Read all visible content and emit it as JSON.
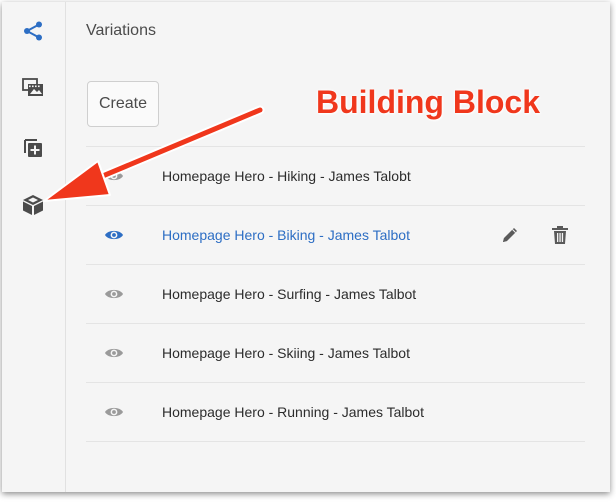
{
  "rail": {
    "items": [
      {
        "icon": "share-icon",
        "color": "#2d6ec4"
      },
      {
        "icon": "images-icon",
        "color": "#4b4b4b"
      },
      {
        "icon": "add-copy-icon",
        "color": "#4b4b4b"
      },
      {
        "icon": "cube-icon",
        "color": "#4b4b4b"
      }
    ]
  },
  "panel": {
    "title": "Variations",
    "create_label": "Create"
  },
  "variations": [
    {
      "label": "Homepage Hero - Hiking - James Talobt",
      "active": false
    },
    {
      "label": "Homepage Hero - Biking - James Talbot",
      "active": true
    },
    {
      "label": "Homepage Hero - Surfing - James Talbot",
      "active": false
    },
    {
      "label": "Homepage Hero - Skiing - James Talbot",
      "active": false
    },
    {
      "label": "Homepage Hero - Running - James Talbot",
      "active": false
    }
  ],
  "row_actions": [
    "edit-icon",
    "delete-icon"
  ],
  "annotation": {
    "text": "Building Block",
    "color": "#f0371c"
  },
  "colors": {
    "accent": "#2d6ec4",
    "icon_gray": "#9a9a9a"
  }
}
